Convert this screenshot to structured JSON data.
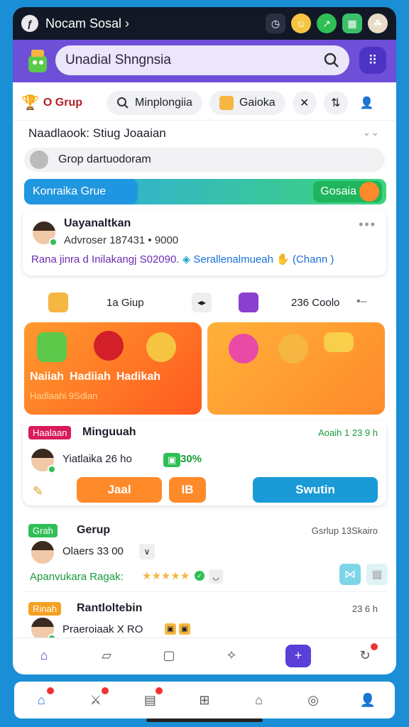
{
  "status_bar": {
    "app_title": "Nocam Sosal ›"
  },
  "search": {
    "placeholder": "Unadial Shngnsia"
  },
  "chips": {
    "group_label": "O Grup",
    "search_chip": "Minplongiia",
    "gold_chip": "Gaioka"
  },
  "composer": {
    "title": "Naadlaook: Stiug Joaaian",
    "input_placeholder": "Grop dartuodoram"
  },
  "banner": {
    "left_label": "Konraika Grue",
    "right_label": "Gosaia"
  },
  "post1": {
    "name": "Uayanaltkan",
    "meta": "Advroser 187431 • 9000",
    "body_left": "Rana jinra d Inilakangj S02090.",
    "body_right": "Serallenalmueah",
    "body_tail": "(Chann )"
  },
  "stats": {
    "group_count": "1a Giup",
    "cool_count": "236 Coolo"
  },
  "promo_left": {
    "labels": [
      "Naiiah",
      "Hadiiah",
      "Hadikah"
    ],
    "sub": "Hadlaahi 9Sdlan"
  },
  "post2": {
    "badge": "Haalaan",
    "name": "Minguuah",
    "time": "Aoaih 1 23 9 h",
    "meta": "Yiatlaika 26 ho",
    "percent": "30%",
    "btn_join": "Jaal",
    "btn_ib": "IB",
    "btn_switch": "Swutin"
  },
  "post3": {
    "badge": "Grah",
    "name": "Gerup",
    "time": "Gsrlup 13Skairo",
    "meta": "Olaers 33 00",
    "rating_label": "Apanvukara Ragak:",
    "stars": "★★★★★"
  },
  "post4": {
    "badge": "Rinah",
    "name": "Rantloltebin",
    "time": "23 6 h",
    "meta": "Praeroiaak X RO"
  },
  "colors": {
    "accent": "#6d4fd8",
    "orange": "#ff8a2a",
    "blue": "#2196e0",
    "green": "#2fbf55"
  }
}
